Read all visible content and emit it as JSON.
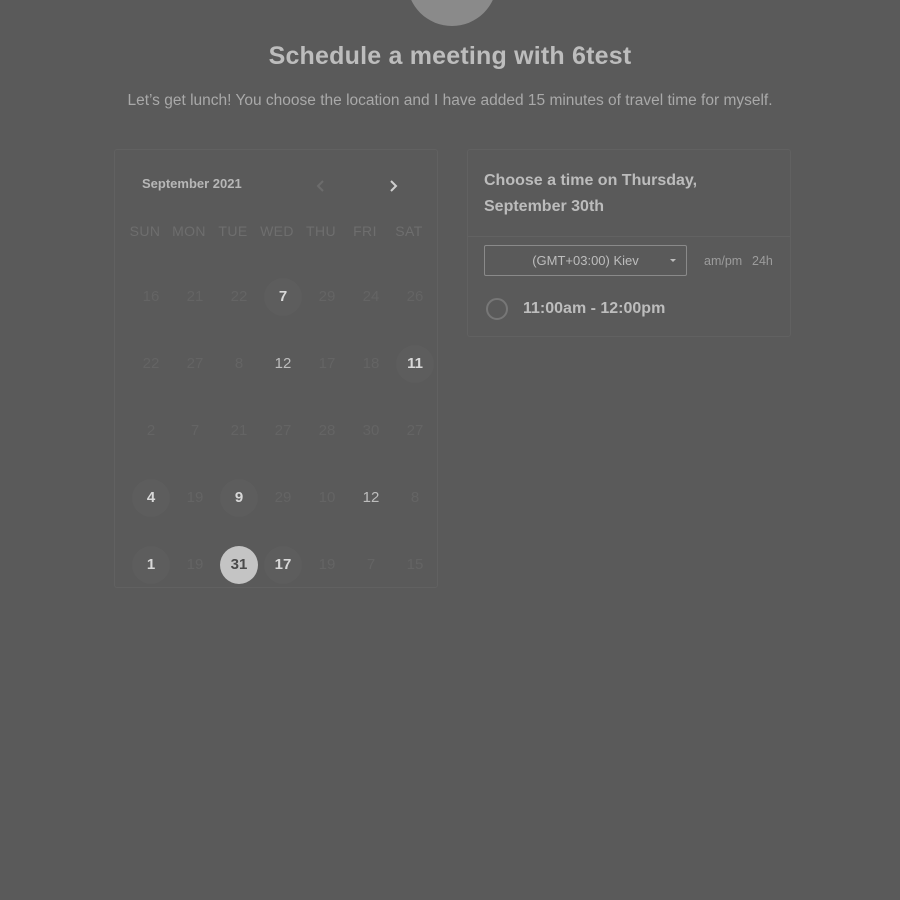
{
  "header": {
    "title": "Schedule a meeting with 6test",
    "subtitle": "Let’s get lunch! You choose the location and I have added 15 minutes of travel time for myself."
  },
  "calendar": {
    "month_label": "September 2021",
    "weekdays": [
      "SUN",
      "MON",
      "TUE",
      "WED",
      "THU",
      "FRI",
      "SAT"
    ],
    "days": [
      {
        "n": "16",
        "s": "muted"
      },
      {
        "n": "21",
        "s": "muted"
      },
      {
        "n": "22",
        "s": "muted"
      },
      {
        "n": "7",
        "s": "avail"
      },
      {
        "n": "29",
        "s": "muted"
      },
      {
        "n": "24",
        "s": "muted"
      },
      {
        "n": "26",
        "s": "muted"
      },
      {
        "n": "22",
        "s": "muted"
      },
      {
        "n": "27",
        "s": "muted"
      },
      {
        "n": "8",
        "s": "muted"
      },
      {
        "n": "12",
        "s": "mid"
      },
      {
        "n": "17",
        "s": "muted"
      },
      {
        "n": "18",
        "s": "muted"
      },
      {
        "n": "11",
        "s": "avail"
      },
      {
        "n": "2",
        "s": "muted"
      },
      {
        "n": "7",
        "s": "muted"
      },
      {
        "n": "21",
        "s": "muted"
      },
      {
        "n": "27",
        "s": "muted"
      },
      {
        "n": "28",
        "s": "muted"
      },
      {
        "n": "30",
        "s": "muted"
      },
      {
        "n": "27",
        "s": "muted"
      },
      {
        "n": "4",
        "s": "avail"
      },
      {
        "n": "19",
        "s": "muted"
      },
      {
        "n": "9",
        "s": "avail"
      },
      {
        "n": "29",
        "s": "muted"
      },
      {
        "n": "10",
        "s": "muted"
      },
      {
        "n": "12",
        "s": "mid"
      },
      {
        "n": "8",
        "s": "muted"
      },
      {
        "n": "1",
        "s": "avail"
      },
      {
        "n": "19",
        "s": "muted"
      },
      {
        "n": "31",
        "s": "sel"
      },
      {
        "n": "17",
        "s": "avail"
      },
      {
        "n": "19",
        "s": "muted"
      },
      {
        "n": "7",
        "s": "muted"
      },
      {
        "n": "15",
        "s": "muted"
      }
    ]
  },
  "time_panel": {
    "heading_line1": "Choose a time on Thursday,",
    "heading_line2": "September 30th",
    "timezone": "(GMT+03:00) Kiev",
    "format_ampm": "am/pm",
    "format_24h": "24h",
    "slots": [
      "11:00am - 12:00pm"
    ]
  },
  "colors": {
    "background": "#5a5a5a",
    "selected_day": "#c4c4c4"
  }
}
